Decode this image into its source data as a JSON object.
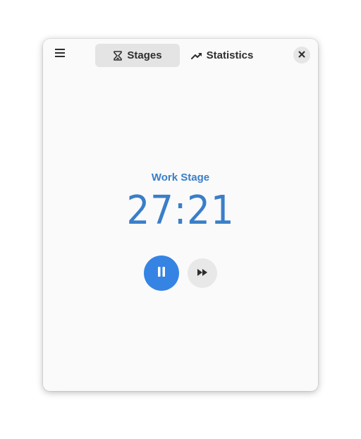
{
  "header": {
    "menu_icon": "hamburger-menu-icon",
    "tabs": [
      {
        "label": "Stages",
        "icon": "hourglass-icon",
        "active": true
      },
      {
        "label": "Statistics",
        "icon": "trending-up-icon",
        "active": false
      }
    ],
    "close_icon": "close-icon"
  },
  "timer": {
    "stage_label": "Work Stage",
    "time": "27:21"
  },
  "controls": {
    "pause_icon": "pause-icon",
    "skip_icon": "skip-forward-icon"
  },
  "colors": {
    "accent": "#3584e4",
    "accent_text": "#3a7ec9",
    "window_bg": "#fafafa",
    "active_tab_bg": "#e4e4e4"
  }
}
